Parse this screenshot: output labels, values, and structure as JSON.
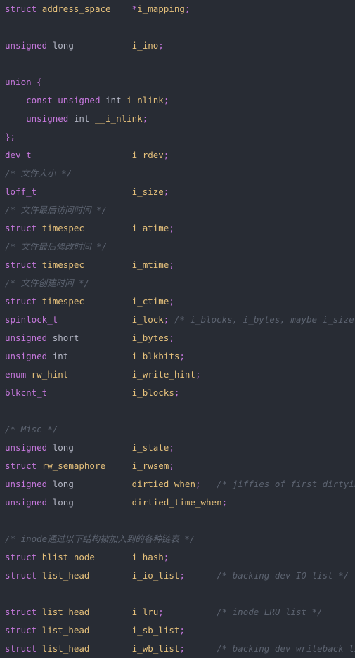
{
  "editor": {
    "background_color": "#282c34",
    "language": "c",
    "font_size_px": 12.5,
    "line_height_px": 26,
    "colors": {
      "keyword": "#c678dd",
      "type": "#e5c07b",
      "identifier": "#e5c07b",
      "primitive": "#b3b6c4",
      "punctuation": "#c678dd",
      "comment": "#5c6370"
    }
  },
  "lines": [
    {
      "id": 1,
      "text": "struct address_space    *i_mapping;"
    },
    {
      "id": 2,
      "text": ""
    },
    {
      "id": 3,
      "text": "unsigned long           i_ino;"
    },
    {
      "id": 4,
      "text": ""
    },
    {
      "id": 5,
      "text": "union {"
    },
    {
      "id": 6,
      "text": "    const unsigned int i_nlink;"
    },
    {
      "id": 7,
      "text": "    unsigned int __i_nlink;"
    },
    {
      "id": 8,
      "text": "};"
    },
    {
      "id": 9,
      "text": "dev_t                   i_rdev;"
    },
    {
      "id": 10,
      "text": "/* 文件大小 */"
    },
    {
      "id": 11,
      "text": "loff_t                  i_size;"
    },
    {
      "id": 12,
      "text": "/* 文件最后访问时间 */"
    },
    {
      "id": 13,
      "text": "struct timespec         i_atime;"
    },
    {
      "id": 14,
      "text": "/* 文件最后修改时间 */"
    },
    {
      "id": 15,
      "text": "struct timespec         i_mtime;"
    },
    {
      "id": 16,
      "text": "/* 文件创建时间 */"
    },
    {
      "id": 17,
      "text": "struct timespec         i_ctime;"
    },
    {
      "id": 18,
      "text": "spinlock_t              i_lock; /* i_blocks, i_bytes, maybe i_size */"
    },
    {
      "id": 19,
      "text": "unsigned short          i_bytes;"
    },
    {
      "id": 20,
      "text": "unsigned int            i_blkbits;"
    },
    {
      "id": 21,
      "text": "enum rw_hint            i_write_hint;"
    },
    {
      "id": 22,
      "text": "blkcnt_t                i_blocks;"
    },
    {
      "id": 23,
      "text": ""
    },
    {
      "id": 24,
      "text": "/* Misc */"
    },
    {
      "id": 25,
      "text": "unsigned long           i_state;"
    },
    {
      "id": 26,
      "text": "struct rw_semaphore     i_rwsem;"
    },
    {
      "id": 27,
      "text": "unsigned long           dirtied_when;   /* jiffies of first dirtying */"
    },
    {
      "id": 28,
      "text": "unsigned long           dirtied_time_when;"
    },
    {
      "id": 29,
      "text": ""
    },
    {
      "id": 30,
      "text": "/* inode通过以下结构被加入到的各种链表 */"
    },
    {
      "id": 31,
      "text": "struct hlist_node       i_hash;"
    },
    {
      "id": 32,
      "text": "struct list_head        i_io_list;      /* backing dev IO list */"
    },
    {
      "id": 33,
      "text": ""
    },
    {
      "id": 34,
      "text": "struct list_head        i_lru;          /* inode LRU list */"
    },
    {
      "id": 35,
      "text": "struct list_head        i_sb_list;"
    },
    {
      "id": 36,
      "text": "struct list_head        i_wb_list;      /* backing dev writeback list */"
    }
  ],
  "tokens": {
    "keywords": [
      "struct",
      "union",
      "const",
      "enum",
      "unsigned",
      "dev_t",
      "loff_t",
      "spinlock_t",
      "blkcnt_t"
    ],
    "primitives": [
      "int",
      "short",
      "long"
    ],
    "types": [
      "address_space",
      "timespec",
      "rw_semaphore",
      "hlist_node",
      "list_head",
      "rw_hint"
    ]
  }
}
